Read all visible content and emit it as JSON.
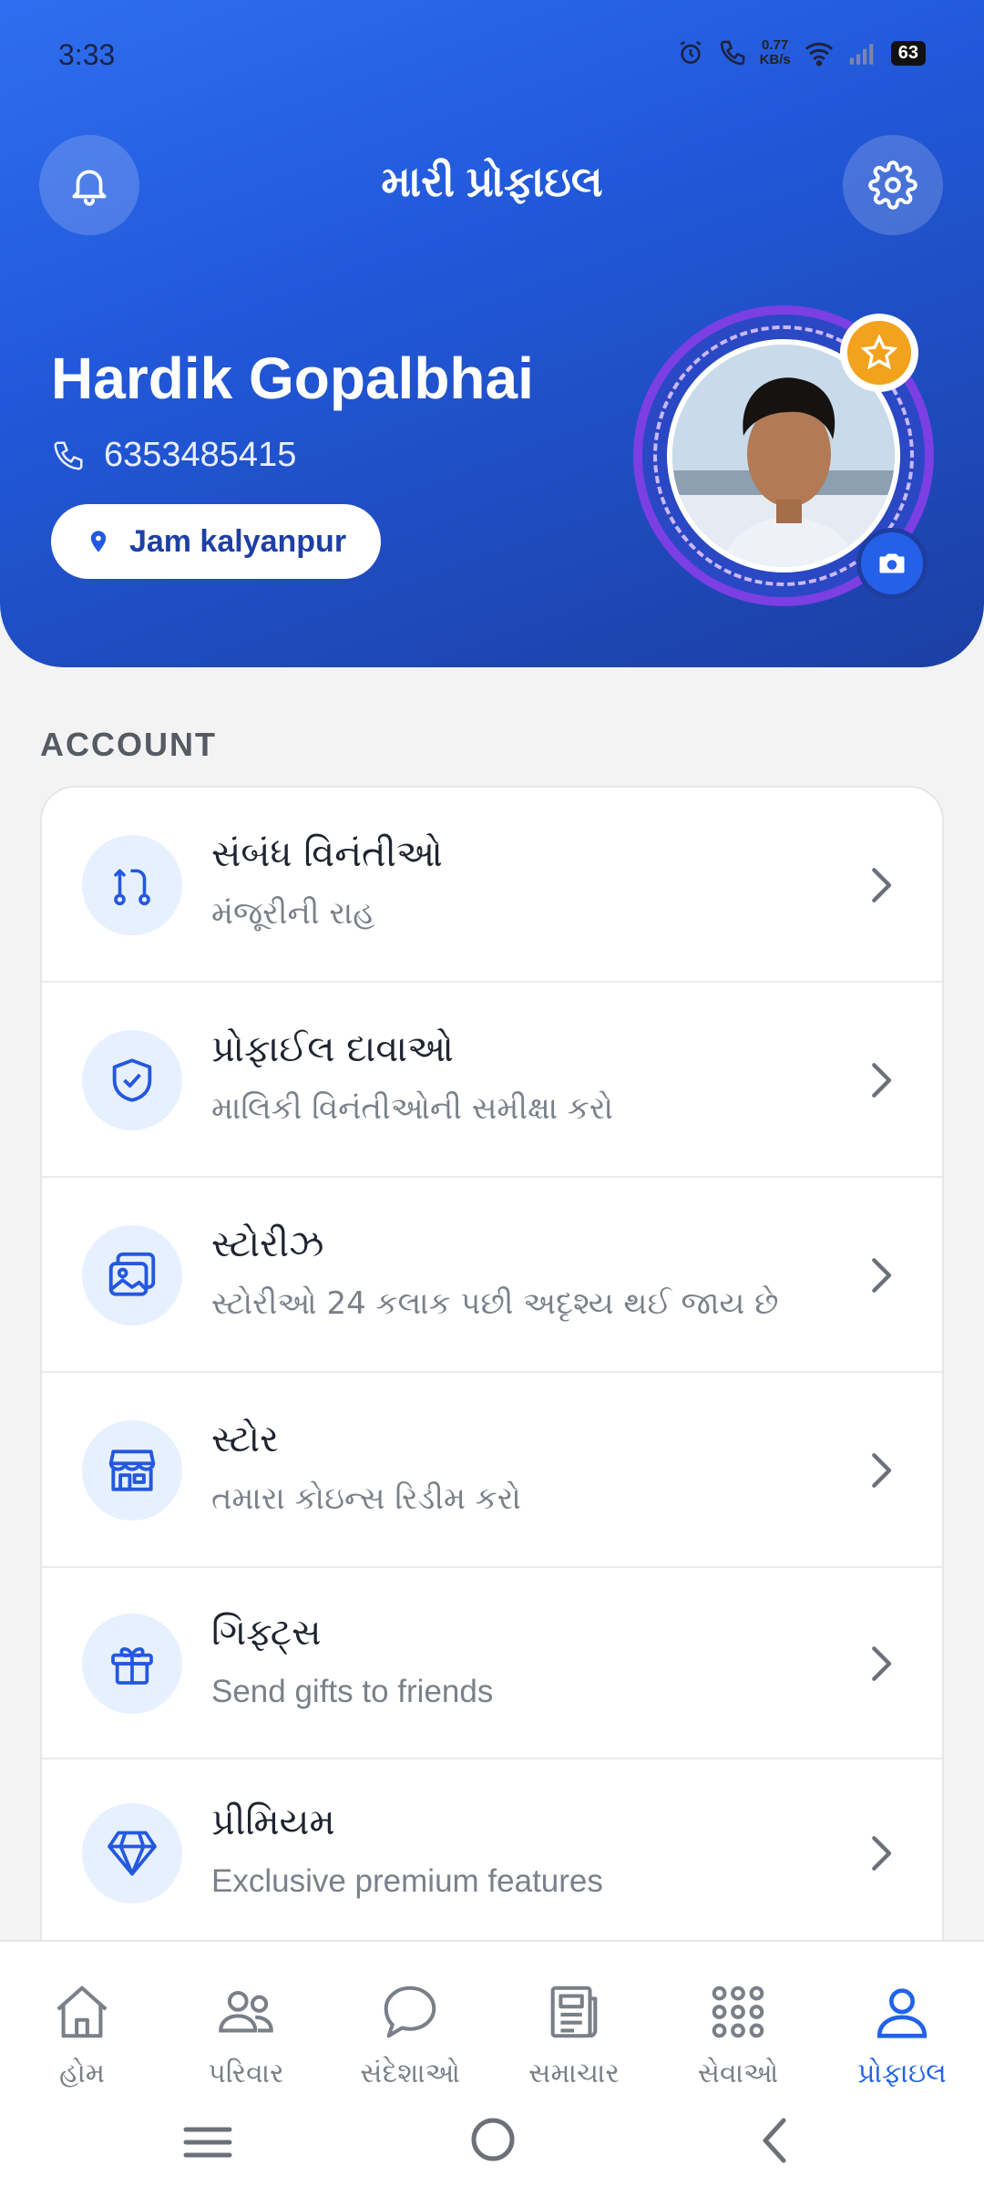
{
  "status": {
    "time": "3:33",
    "net_speed_value": "0.77",
    "net_speed_unit": "KB/s",
    "battery": "63"
  },
  "header": {
    "title": "મારી પ્રોફાઇલ"
  },
  "profile": {
    "name": "Hardik Gopalbhai",
    "phone": "6353485415",
    "location": "Jam kalyanpur"
  },
  "account": {
    "section_label": "ACCOUNT",
    "items": [
      {
        "title": "સંબંધ વિનંતીઓ",
        "subtitle": "મંજૂરીની રાહ",
        "icon": "route-icon"
      },
      {
        "title": "પ્રોફાઈલ દાવાઓ",
        "subtitle": "માલિકી વિનંતીઓની સમીક્ષા કરો",
        "icon": "shield-check-icon"
      },
      {
        "title": "સ્ટોરીઝ",
        "subtitle": "સ્ટોરીઓ 24 કલાક પછી અદૃશ્ય થઈ જાય છે",
        "icon": "images-icon"
      },
      {
        "title": "સ્ટોર",
        "subtitle": "તમારા કોઇન્સ રિડીમ કરો",
        "icon": "store-icon"
      },
      {
        "title": "ગિફ્ટ્સ",
        "subtitle": "Send gifts to friends",
        "icon": "gift-icon"
      },
      {
        "title": "પ્રીમિયમ",
        "subtitle": "Exclusive premium features",
        "icon": "diamond-icon"
      }
    ]
  },
  "nav": {
    "items": [
      {
        "label": "હોમ",
        "icon": "home-icon"
      },
      {
        "label": "પરિવાર",
        "icon": "users-icon"
      },
      {
        "label": "સંદેશાઓ",
        "icon": "chat-icon"
      },
      {
        "label": "સમાચાર",
        "icon": "newspaper-icon"
      },
      {
        "label": "સેવાઓ",
        "icon": "grid-icon"
      },
      {
        "label": "પ્રોફાઇલ",
        "icon": "user-icon"
      }
    ],
    "active_index": 5
  },
  "colors": {
    "accent": "#2063e8",
    "header_dark": "#1c3fa3",
    "badge": "#f3a21d"
  }
}
